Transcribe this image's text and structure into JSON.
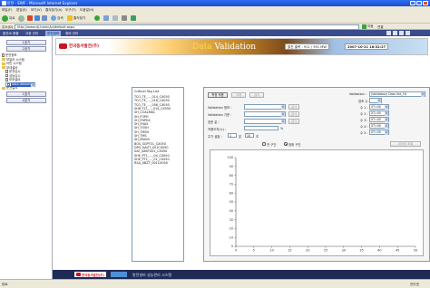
{
  "window": {
    "title": "안전 - EWF - Microsoft Internet Explorer"
  },
  "menu": [
    "파일(F)",
    "편집(E)",
    "보기(V)",
    "즐겨찾기(A)",
    "도구(T)",
    "도움말(H)"
  ],
  "toolbar": {
    "back": "뒤로",
    "search": "검색",
    "favorites": "즐겨찾기"
  },
  "address": {
    "label": "주소(D)",
    "url": "http://www.dj-lubric/ip/default.aspx",
    "go": "이동",
    "links": "연결"
  },
  "appnav": {
    "items": [
      "발전소 현황",
      "고장 관리",
      "운전정보",
      "정비 관리"
    ],
    "active_index": 2
  },
  "sidebar": {
    "buttons": [
      "1호기",
      "2호기",
      "1호기",
      "4호기"
    ],
    "tree": [
      {
        "label": "운전정보",
        "type": "doc"
      },
      {
        "label": "보일러 시스템",
        "type": "folder"
      },
      {
        "label": "터빈 시스템",
        "type": "folder"
      },
      {
        "label": "부대설비",
        "type": "folder"
      },
      {
        "label": "운전감시",
        "type": "doc"
      },
      {
        "label": "성능감시",
        "type": "doc"
      },
      {
        "label": "보조설비",
        "type": "doc"
      },
      {
        "label": "Data Validation",
        "type": "doc",
        "selected": true
      },
      {
        "label": "운전일지",
        "type": "folder"
      }
    ]
  },
  "banner": {
    "company": "한국동서발전(주)",
    "title_prefix": "Data",
    "title_rest": " Validation",
    "status": "발전 출력 : 911 / 951 MW",
    "datetime": "2007-10-21 16:32:27"
  },
  "taglist": {
    "header": "Critical Tag List",
    "items": [
      "TCO_TE_..._014_CX050",
      "TCO_TE_..._018_CX050",
      "TCO_TE_..._058_CX050",
      "SHR_FLT_..._014_CX050",
      "SH_COALMAC",
      "SH_FOPH",
      "SH_FNPH4",
      "SH_FNA5",
      "SH_TOSH",
      "SH_TMSH",
      "SH_TMS",
      "SH_MW45",
      "BOS_SGPT01_CX050",
      "DPG_NAZT_001CX050",
      "SAF_ABST001_CX050",
      "SHE_PT1_..._04_CX050",
      "SHE_PT1_..._01_CX050",
      "RSA_XBZT_001CX050"
    ]
  },
  "panel": {
    "buttons": {
      "measure": "측정 적용",
      "delete": "삭제",
      "test": "검사"
    },
    "fields": [
      {
        "label": "Validation 정보 :",
        "button": "검사"
      },
      {
        "label": "Validation 기준 :",
        "button": "검사"
      },
      {
        "label": "표준 값 :",
        "button": "검사"
      },
      {
        "label": "허용오차(±) :",
        "unit": "%"
      }
    ],
    "cycle": {
      "label": "주기 설정 :",
      "minutes": "1",
      "seconds": "10",
      "min_unit": "분",
      "sec_unit": "초"
    },
    "right": {
      "label1": "Validation :",
      "value1": "(Validation) Data Set_18",
      "label2": "참조 수 :",
      "rows": [
        {
          "label": "수 1 :",
          "value": "XT=00"
        },
        {
          "label": "수 2 :",
          "value": "XT=00"
        },
        {
          "label": "수 3 :",
          "value": "XT=00"
        },
        {
          "label": "수 4 :",
          "value": "XT=00"
        },
        {
          "label": "수 5 :",
          "value": "XT=00"
        }
      ]
    },
    "radios": {
      "option1": "전 구간",
      "option2": "범위 구간",
      "selected": 2
    },
    "query_button": "데이터 조회"
  },
  "chart_data": {
    "type": "line",
    "title": "",
    "xlabel": "",
    "ylabel": "",
    "xlim": [
      0,
      50
    ],
    "ylim": [
      0,
      100
    ],
    "xticks": [
      0,
      5,
      10,
      15,
      20,
      25,
      30,
      35,
      40,
      45,
      50
    ],
    "yticks": [
      0,
      10,
      20,
      30,
      40,
      50,
      60,
      70,
      80,
      90,
      100
    ],
    "series": []
  },
  "bottom": {
    "company": "한국동서발전(주)",
    "tagline": "발전설비 성능관리 시스템"
  },
  "statusbar": {
    "left": "완료",
    "right": "인터넷"
  },
  "colors": {
    "nav": "#3a4c8c",
    "banner_title": "#ffffff",
    "accent": "#c8141e"
  }
}
